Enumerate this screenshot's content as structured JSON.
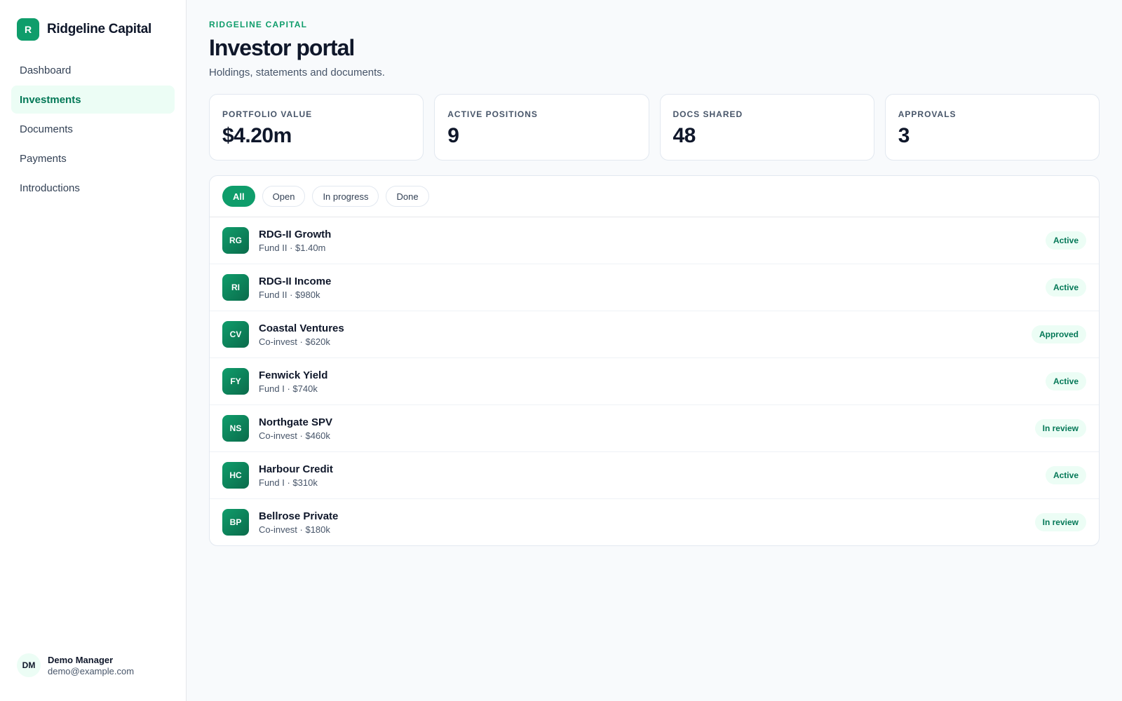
{
  "brand": {
    "logo_letter": "R",
    "name": "Ridgeline Capital"
  },
  "nav": [
    {
      "label": "Dashboard",
      "active": false
    },
    {
      "label": "Investments",
      "active": true
    },
    {
      "label": "Documents",
      "active": false
    },
    {
      "label": "Payments",
      "active": false
    },
    {
      "label": "Introductions",
      "active": false
    }
  ],
  "user": {
    "initials": "DM",
    "name": "Demo Manager",
    "email": "demo@example.com"
  },
  "header": {
    "eyebrow": "RIDGELINE CAPITAL",
    "title": "Investor portal",
    "subtitle": "Holdings, statements and documents."
  },
  "stats": [
    {
      "label": "PORTFOLIO VALUE",
      "value": "$4.20m"
    },
    {
      "label": "ACTIVE POSITIONS",
      "value": "9"
    },
    {
      "label": "DOCS SHARED",
      "value": "48"
    },
    {
      "label": "APPROVALS",
      "value": "3"
    }
  ],
  "filters": [
    {
      "label": "All",
      "active": true
    },
    {
      "label": "Open",
      "active": false
    },
    {
      "label": "In progress",
      "active": false
    },
    {
      "label": "Done",
      "active": false
    }
  ],
  "investments": [
    {
      "initials": "RG",
      "name": "RDG-II Growth",
      "detail": "Fund II · $1.40m",
      "status": "Active"
    },
    {
      "initials": "RI",
      "name": "RDG-II Income",
      "detail": "Fund II · $980k",
      "status": "Active"
    },
    {
      "initials": "CV",
      "name": "Coastal Ventures",
      "detail": "Co-invest · $620k",
      "status": "Approved"
    },
    {
      "initials": "FY",
      "name": "Fenwick Yield",
      "detail": "Fund I · $740k",
      "status": "Active"
    },
    {
      "initials": "NS",
      "name": "Northgate SPV",
      "detail": "Co-invest · $460k",
      "status": "In review"
    },
    {
      "initials": "HC",
      "name": "Harbour Credit",
      "detail": "Fund I · $310k",
      "status": "Active"
    },
    {
      "initials": "BP",
      "name": "Bellrose Private",
      "detail": "Co-invest · $180k",
      "status": "In review"
    }
  ],
  "colors": {
    "accent": "#0f9d6b",
    "accent_soft": "#ecfdf5",
    "accent_text": "#047857"
  }
}
